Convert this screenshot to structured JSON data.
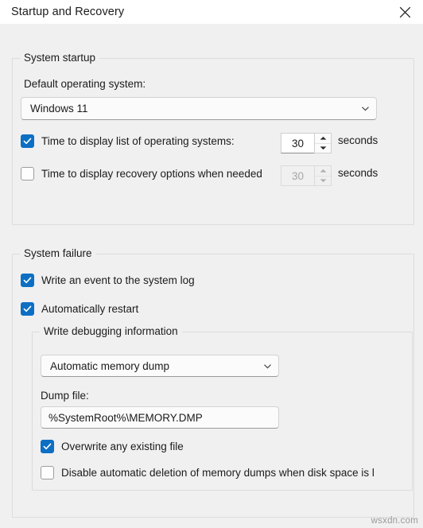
{
  "window": {
    "title": "Startup and Recovery",
    "close_icon": "close-icon"
  },
  "system_startup": {
    "group_label": "System startup",
    "default_os_label": "Default operating system:",
    "default_os_value": "Windows 11",
    "os_list_timeout": {
      "label": "Time to display list of operating systems:",
      "checked": true,
      "value": "30",
      "unit": "seconds"
    },
    "recovery_timeout": {
      "label": "Time to display recovery options when needed",
      "checked": false,
      "value": "30",
      "unit": "seconds"
    }
  },
  "system_failure": {
    "group_label": "System failure",
    "write_event": {
      "label": "Write an event to the system log",
      "checked": true
    },
    "auto_restart": {
      "label": "Automatically restart",
      "checked": true
    },
    "write_debugging": {
      "group_label": "Write debugging information",
      "dump_type_value": "Automatic memory dump",
      "dump_file_label": "Dump file:",
      "dump_file_value": "%SystemRoot%\\MEMORY.DMP",
      "overwrite": {
        "label": "Overwrite any existing file",
        "checked": true
      },
      "disable_auto_delete": {
        "label": "Disable automatic deletion of memory dumps when disk space is l",
        "checked": false
      }
    }
  },
  "watermark": "wsxdn.com",
  "colors": {
    "accent": "#0d6fc4",
    "window_bg": "#f0f0f0",
    "titlebar_bg": "#ffffff",
    "border": "#dcdcdc",
    "text": "#1b1b1b",
    "disabled_text": "#a6a6a6"
  }
}
